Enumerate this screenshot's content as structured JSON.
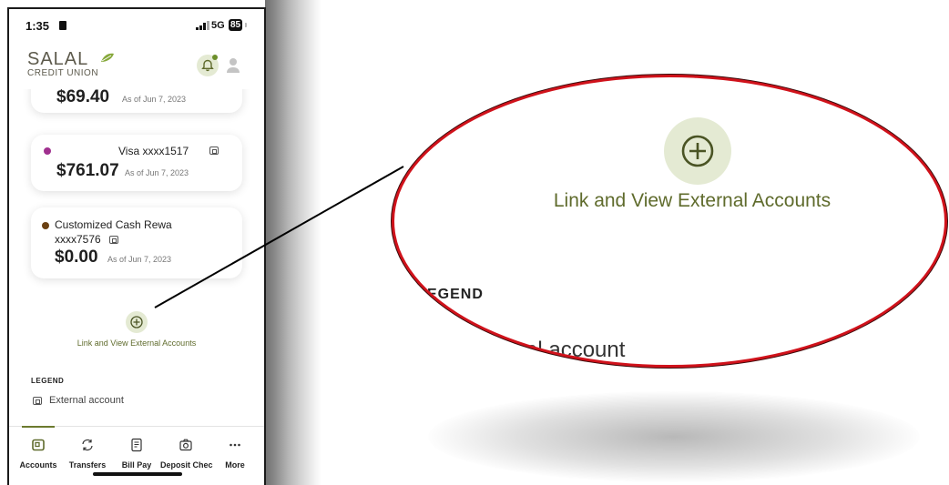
{
  "status_bar": {
    "time": "1:35",
    "network": "5G",
    "battery": "85"
  },
  "header": {
    "logo_name": "SALAL",
    "logo_subtitle": "CREDIT UNION"
  },
  "accounts": [
    {
      "name": "",
      "balance": "$69.40",
      "as_of": "As of Jun 7, 2023",
      "dot_color": ""
    },
    {
      "name": "Visa  xxxx1517",
      "balance": "$761.07",
      "as_of": "As of Jun 7, 2023",
      "dot_color": "#a0308f"
    },
    {
      "name": "Customized Cash Rewa",
      "name_line2": "xxxx7576",
      "balance": "$0.00",
      "as_of": "As of Jun 7, 2023",
      "dot_color": "#6b4113"
    }
  ],
  "link_external": {
    "label": "Link and View External Accounts"
  },
  "legend": {
    "title": "LEGEND",
    "external": "External account"
  },
  "tabs": [
    {
      "label": "Accounts",
      "icon": "accounts-icon"
    },
    {
      "label": "Transfers",
      "icon": "transfers-icon"
    },
    {
      "label": "Bill Pay",
      "icon": "bill-pay-icon"
    },
    {
      "label": "Deposit Chec",
      "icon": "camera-icon"
    },
    {
      "label": "More",
      "icon": "more-icon"
    }
  ],
  "zoom": {
    "label": "Link and View External Accounts",
    "legend_fragment": "EGEND",
    "legend_item_fragment": "al account"
  },
  "colors": {
    "accent": "#5f6b2c",
    "accent_bg": "#e4ead3",
    "callout_border": "#d0121b"
  }
}
